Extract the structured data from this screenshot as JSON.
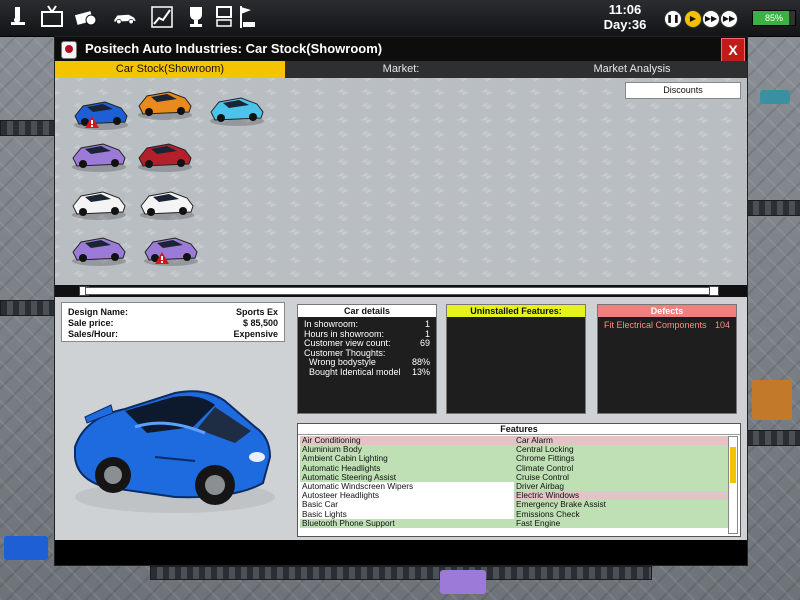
{
  "clock": {
    "time": "11:06",
    "day": "Day:36"
  },
  "speed_controls": {
    "pause": "❚❚",
    "play": "▶",
    "fast": "▶▶",
    "fastest": "▶▶"
  },
  "progress": {
    "value_pct": 85,
    "label": "85%"
  },
  "top_icons": [
    "research-icon",
    "tv-icon",
    "money-icon",
    "car-icon",
    "chart-icon",
    "trophy-icon",
    "computer-icon",
    "flag-icon"
  ],
  "dialog": {
    "title": "Positech Auto Industries: Car Stock(Showroom)",
    "close_label": "X",
    "tabs": [
      {
        "label": "Car Stock(Showroom)",
        "active": true
      },
      {
        "label": "Market:",
        "active": false
      },
      {
        "label": "Market Analysis",
        "active": false
      }
    ],
    "discounts_label": "Discounts"
  },
  "showroom_cars": [
    {
      "color": "#1e5fd6",
      "warning": true
    },
    {
      "color": "#e88a1c",
      "warning": false
    },
    {
      "color": "#4cc3ea",
      "warning": false
    },
    {
      "color": "#9b7ad8",
      "warning": false
    },
    {
      "color": "#b3202c",
      "warning": false
    },
    {
      "color": "#f4f4f4",
      "warning": false
    },
    {
      "color": "#f4f4f4",
      "warning": false
    },
    {
      "color": "#9b7ad8",
      "warning": false
    },
    {
      "color": "#9b7ad8",
      "warning": true
    }
  ],
  "summary": {
    "design_name_label": "Design Name:",
    "design_name": "Sports Ex",
    "sale_price_label": "Sale price:",
    "sale_price": "$ 85,500",
    "sales_hour_label": "Sales/Hour:",
    "sales_hour": "Expensive"
  },
  "car_details": {
    "title": "Car details",
    "rows": [
      {
        "label": "In showroom:",
        "value": "1"
      },
      {
        "label": "Hours in showroom:",
        "value": "1"
      },
      {
        "label": "Customer view count:",
        "value": "69"
      },
      {
        "label": "Customer Thoughts:",
        "value": ""
      },
      {
        "label": "Wrong bodystyle",
        "value": "88%"
      },
      {
        "label": "Bought Identical model",
        "value": "13%"
      }
    ]
  },
  "uninstalled": {
    "title": "Uninstalled Features:"
  },
  "defects": {
    "title": "Defects",
    "rows": [
      {
        "label": "Fit Electrical Components",
        "value": "104"
      }
    ]
  },
  "features": {
    "title": "Features",
    "rows": [
      {
        "left": "Air Conditioning",
        "left_state": "missing",
        "right": "Car Alarm",
        "right_state": "missing"
      },
      {
        "left": "Aluminium Body",
        "left_state": "installed",
        "right": "Central Locking",
        "right_state": "installed"
      },
      {
        "left": "Ambient Cabin Lighting",
        "left_state": "installed",
        "right": "Chrome Fittings",
        "right_state": "installed"
      },
      {
        "left": "Automatic Headlights",
        "left_state": "installed",
        "right": "Climate Control",
        "right_state": "installed"
      },
      {
        "left": "Automatic Steering Assist",
        "left_state": "installed",
        "right": "Cruise Control",
        "right_state": "installed"
      },
      {
        "left": "Automatic Windscreen Wipers",
        "left_state": "none",
        "right": "Driver Airbag",
        "right_state": "installed"
      },
      {
        "left": "Autosteer Headlights",
        "left_state": "none",
        "right": "Electric Windows",
        "right_state": "missing"
      },
      {
        "left": "Basic Car",
        "left_state": "none",
        "right": "Emergency Brake Assist",
        "right_state": "installed"
      },
      {
        "left": "Basic Lights",
        "left_state": "none",
        "right": "Emissions Check",
        "right_state": "installed"
      },
      {
        "left": "Bluetooth Phone Support",
        "left_state": "installed",
        "right": "Fast Engine",
        "right_state": "installed"
      }
    ]
  },
  "colors": {
    "accent": "#f5c400",
    "close_red": "#c01b1b",
    "featured_car": "#1e6be0",
    "uninstalled_header": "#e6f21c",
    "defects_header": "#f08080"
  }
}
